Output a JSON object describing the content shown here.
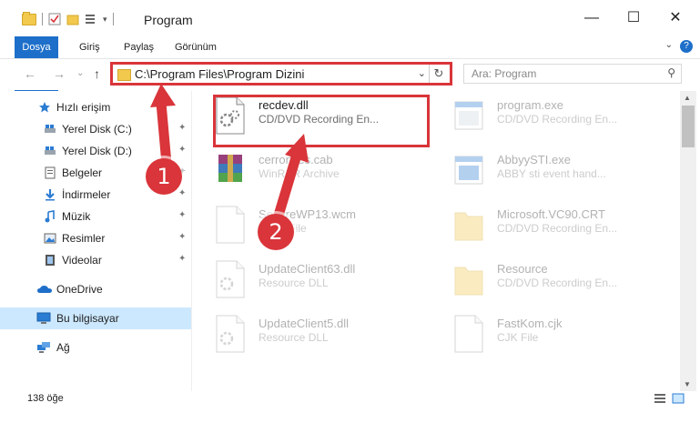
{
  "window": {
    "title": "Program",
    "minimize_glyph": "—",
    "maximize_glyph": "☐",
    "close_glyph": "✕"
  },
  "ribbon": {
    "tabs": [
      "Dosya",
      "Giriş",
      "Paylaş",
      "Görünüm"
    ],
    "help_glyph": "?",
    "collapse_glyph": "⌄"
  },
  "nav": {
    "back_glyph": "←",
    "forward_glyph": "→",
    "recent_glyph": "⌄",
    "up_glyph": "↑"
  },
  "address": {
    "path": "C:\\Program Files\\Program Dizini",
    "dropdown_glyph": "⌄",
    "refresh_glyph": "↻"
  },
  "search": {
    "placeholder": "Ara: Program",
    "icon_glyph": "⚲"
  },
  "sidebar": {
    "quick_access": "Hızlı erişim",
    "items": [
      {
        "label": "Yerel Disk (C:)",
        "icon": "drive-icon",
        "pinned": true
      },
      {
        "label": "Yerel Disk (D:)",
        "icon": "drive-icon",
        "pinned": true
      },
      {
        "label": "Belgeler",
        "icon": "documents-icon",
        "pinned": true
      },
      {
        "label": "İndirmeler",
        "icon": "downloads-icon",
        "pinned": true
      },
      {
        "label": "Müzik",
        "icon": "music-icon",
        "pinned": true
      },
      {
        "label": "Resimler",
        "icon": "pictures-icon",
        "pinned": true
      },
      {
        "label": "Videolar",
        "icon": "videos-icon",
        "pinned": true
      }
    ],
    "onedrive": "OneDrive",
    "this_pc": "Bu bilgisayar",
    "network": "Ağ",
    "pin_glyph": "📌"
  },
  "files": [
    {
      "name": "recdev.dll",
      "desc": "CD/DVD Recording En...",
      "icon": "dll-file-icon",
      "faded": false
    },
    {
      "name": "program.exe",
      "desc": "CD/DVD Recording En...",
      "icon": "exe-file-icon",
      "faded": true
    },
    {
      "name": "cerrorfiles.cab",
      "desc": "WinRAR Archive",
      "icon": "winrar-archive-icon",
      "faded": true
    },
    {
      "name": "AbbyySTI.exe",
      "desc": "ABBY sti event hand...",
      "icon": "exe-file-icon",
      "faded": true
    },
    {
      "name": "SecureWP13.wcm",
      "desc": "WCM File",
      "icon": "generic-file-icon",
      "faded": true
    },
    {
      "name": "Microsoft.VC90.CRT",
      "desc": "CD/DVD Recording En...",
      "icon": "folder-icon",
      "faded": true
    },
    {
      "name": "UpdateClient63.dll",
      "desc": "Resource DLL",
      "icon": "dll-file-icon",
      "faded": true
    },
    {
      "name": "Resource",
      "desc": "CD/DVD Recording En...",
      "icon": "folder-icon",
      "faded": true
    },
    {
      "name": "UpdateClient5.dll",
      "desc": "Resource DLL",
      "icon": "dll-file-icon",
      "faded": true
    },
    {
      "name": "FastKom.cjk",
      "desc": "CJK File",
      "icon": "generic-file-icon",
      "faded": true
    }
  ],
  "status": {
    "item_count": "138 öğe"
  },
  "callouts": {
    "first": "1",
    "second": "2"
  },
  "colors": {
    "accent": "#1e6fc9",
    "highlight_red": "#d9353a",
    "selection": "#cce8ff"
  }
}
